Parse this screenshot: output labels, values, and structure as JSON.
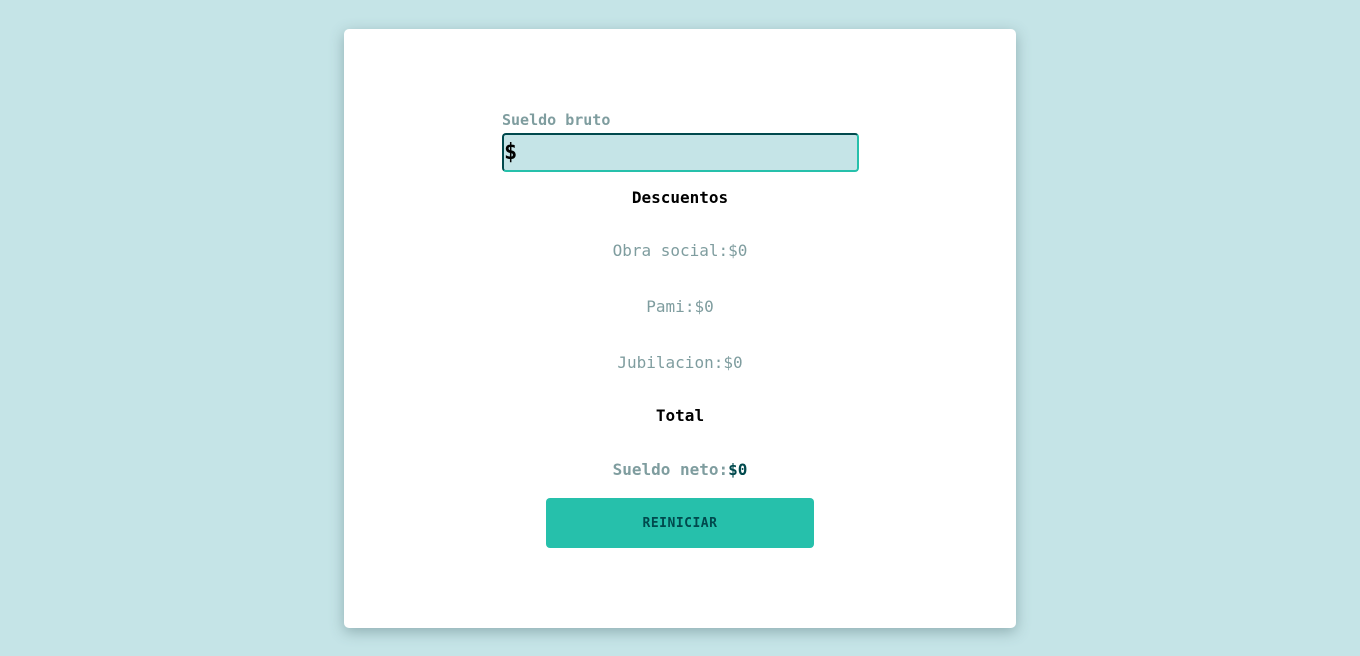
{
  "form": {
    "salary_label": "Sueldo bruto",
    "currency_symbol": "$",
    "salary_value": ""
  },
  "deductions": {
    "heading": "Descuentos",
    "items": [
      {
        "label": "Obra social:",
        "value": "$0"
      },
      {
        "label": "Pami:",
        "value": "$0"
      },
      {
        "label": "Jubilacion:",
        "value": "$0"
      }
    ]
  },
  "total": {
    "heading": "Total",
    "net_label": "Sueldo neto:",
    "net_value": "$0"
  },
  "actions": {
    "reset_label": "REINICIAR"
  },
  "colors": {
    "background": "#c5e4e7",
    "accent": "#26c0ab",
    "dark": "#00494d",
    "muted": "#7f9d9f"
  }
}
